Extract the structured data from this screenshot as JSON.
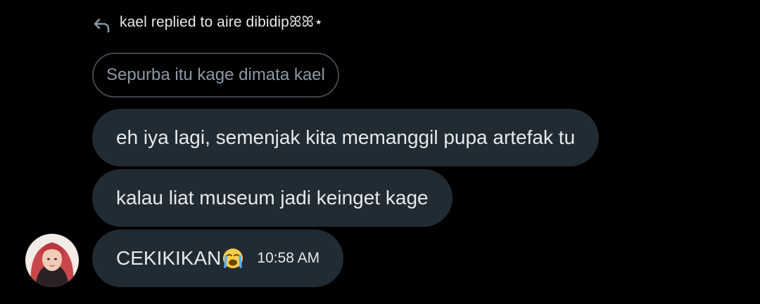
{
  "reply_header": {
    "icon": "reply-arrow-icon",
    "text": "kael replied to aire dibidipꕤꕤ⋆"
  },
  "quoted_message": {
    "text": "Sepurba itu kage dimata kael"
  },
  "messages": [
    {
      "text": "eh iya lagi, semenjak kita memanggil pupa artefak tu"
    },
    {
      "text": "kalau liat museum jadi keinget kage"
    },
    {
      "text": "CEKIKIKAN",
      "emoji": "loudly-crying-face-icon",
      "time": "10:58 AM"
    }
  ],
  "avatar": {
    "icon": "avatar"
  },
  "colors": {
    "background": "#000000",
    "bubble": "#212b33",
    "quoted_border": "#3f464d",
    "text": "#e7e9ea",
    "muted_text": "#8b98a5"
  }
}
